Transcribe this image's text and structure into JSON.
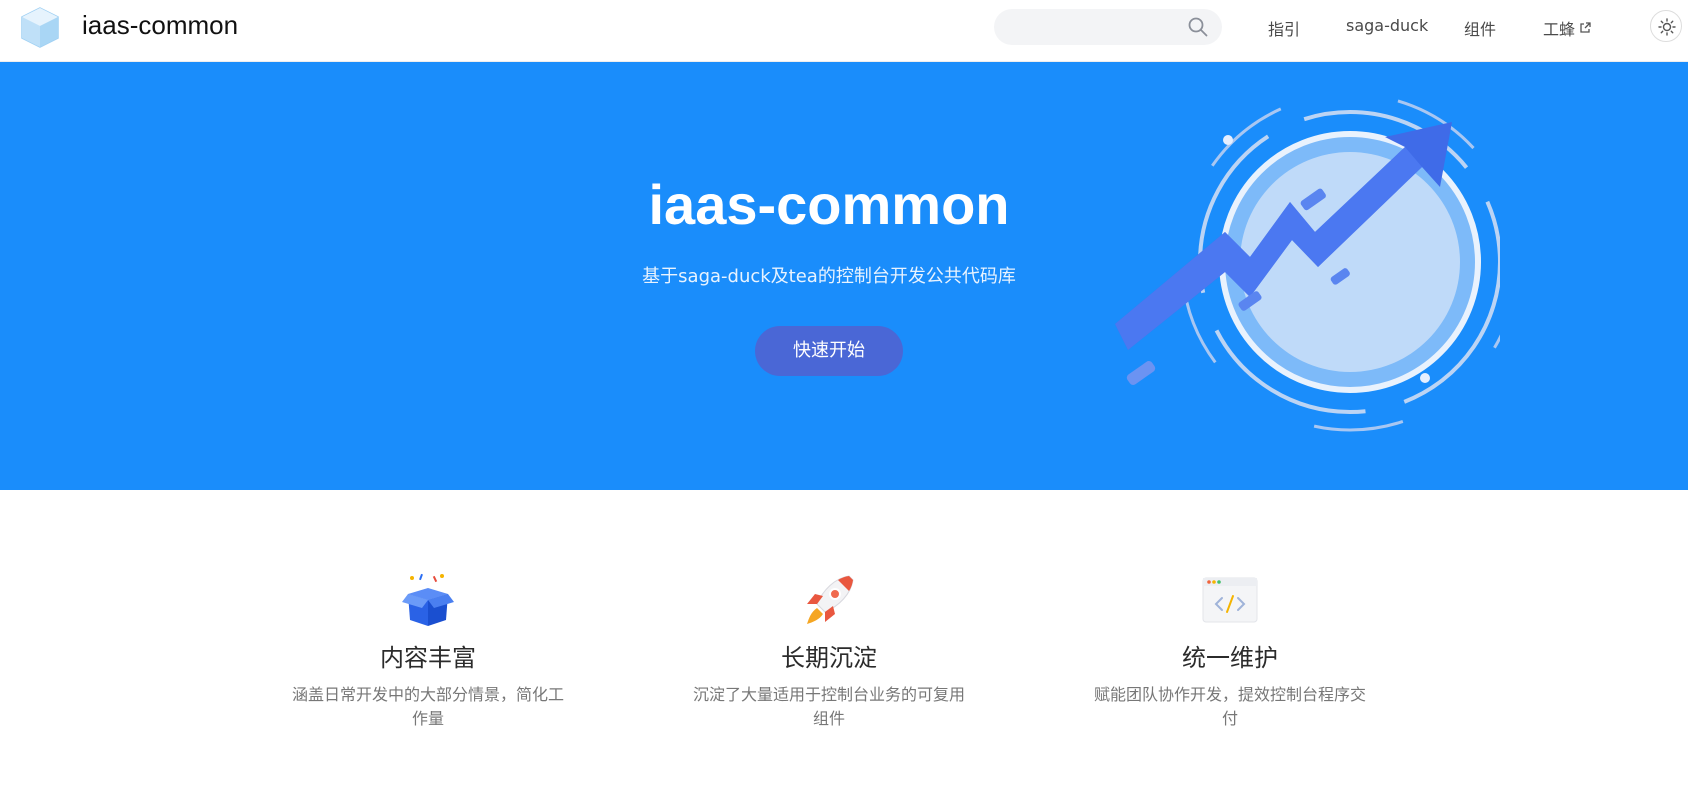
{
  "header": {
    "brand": "iaas-common",
    "search": {
      "placeholder": "",
      "value": ""
    },
    "nav": [
      {
        "label": "指引"
      },
      {
        "label": "saga-duck"
      },
      {
        "label": "组件"
      },
      {
        "label": "工蜂"
      }
    ]
  },
  "hero": {
    "title": "iaas-common",
    "subtitle": "基于saga-duck及tea的控制台开发公共代码库",
    "button_label": "快速开始",
    "background": "#1a8dfb",
    "button_color": "#4a67d6"
  },
  "features": [
    {
      "icon": "gift-box-icon",
      "title": "内容丰富",
      "desc": "涵盖日常开发中的大部分情景，简化工作量"
    },
    {
      "icon": "rocket-icon",
      "title": "长期沉淀",
      "desc": "沉淀了大量适用于控制台业务的可复用组件"
    },
    {
      "icon": "code-window-icon",
      "title": "统一维护",
      "desc": "赋能团队协作开发，提效控制台程序交付"
    }
  ]
}
